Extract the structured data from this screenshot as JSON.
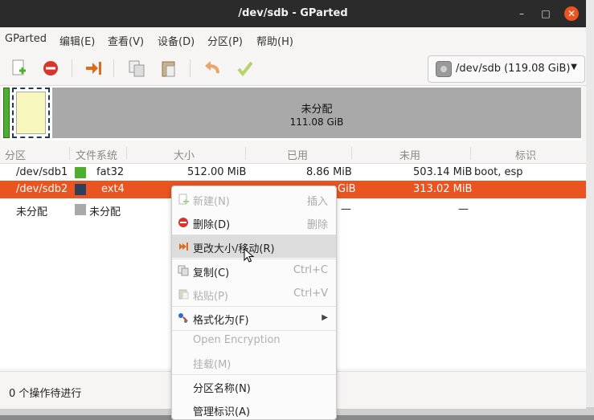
{
  "window": {
    "title": "/dev/sdb - GParted",
    "minimize": "–",
    "maximize": "□",
    "close": "✕"
  },
  "menubar": [
    "GParted",
    "编辑(E)",
    "查看(V)",
    "设备(D)",
    "分区(P)",
    "帮助(H)"
  ],
  "toolbar": {
    "icons": [
      "new-partition-icon",
      "delete-icon",
      "resize-move-icon",
      "copy-icon",
      "paste-icon",
      "undo-icon",
      "apply-icon"
    ],
    "device_selector": "/dev/sdb (119.08 GiB)"
  },
  "disk_graphic": {
    "unallocated_label": "未分配",
    "unallocated_size": "111.08 GiB",
    "colors": {
      "fat32": "#4caf2e",
      "ext4": "#1f3b57",
      "unallocated": "#a9a9a9"
    }
  },
  "partition_list": {
    "columns": [
      "分区",
      "文件系统",
      "大小",
      "已用",
      "未用",
      "标识"
    ],
    "rows": [
      {
        "partition": "/dev/sdb1",
        "fs": "fat32",
        "size": "512.00 MiB",
        "used": "8.86 MiB",
        "unused": "503.14 MiB",
        "flags": "boot, esp",
        "color": "#4caf2e"
      },
      {
        "partition": "/dev/sdb2",
        "fs": "ext4",
        "used_partial": "GiB",
        "unused": "313.02 MiB",
        "color": "#2e3f5c"
      },
      {
        "partition": "未分配",
        "fs": "未分配",
        "used": "—",
        "unused": "—",
        "color": "#a9a9a9"
      }
    ]
  },
  "status": "0 个操作待进行",
  "context_menu": {
    "items": [
      {
        "label": "新建(N)",
        "accel": "插入",
        "enabled": false,
        "icon": "new-partition-icon"
      },
      {
        "label": "删除(D)",
        "accel": "删除",
        "enabled": true,
        "icon": "delete-icon"
      },
      {
        "label": "更改大小/移动(R)",
        "accel": "",
        "enabled": true,
        "icon": "resize-move-icon"
      },
      {
        "label": "复制(C)",
        "accel": "Ctrl+C",
        "enabled": true,
        "icon": "copy-icon"
      },
      {
        "label": "粘贴(P)",
        "accel": "Ctrl+V",
        "enabled": false,
        "icon": "paste-icon"
      },
      {
        "label": "格式化为(F)",
        "accel": "",
        "enabled": true,
        "icon": "format-icon"
      },
      {
        "label": "Open Encryption",
        "accel": "",
        "enabled": false,
        "icon": ""
      },
      {
        "label": "挂载(M)",
        "accel": "",
        "enabled": false,
        "icon": ""
      },
      {
        "label": "分区名称(N)",
        "accel": "",
        "enabled": true,
        "icon": ""
      },
      {
        "label": "管理标识(A)",
        "accel": "",
        "enabled": true,
        "icon": ""
      }
    ]
  }
}
